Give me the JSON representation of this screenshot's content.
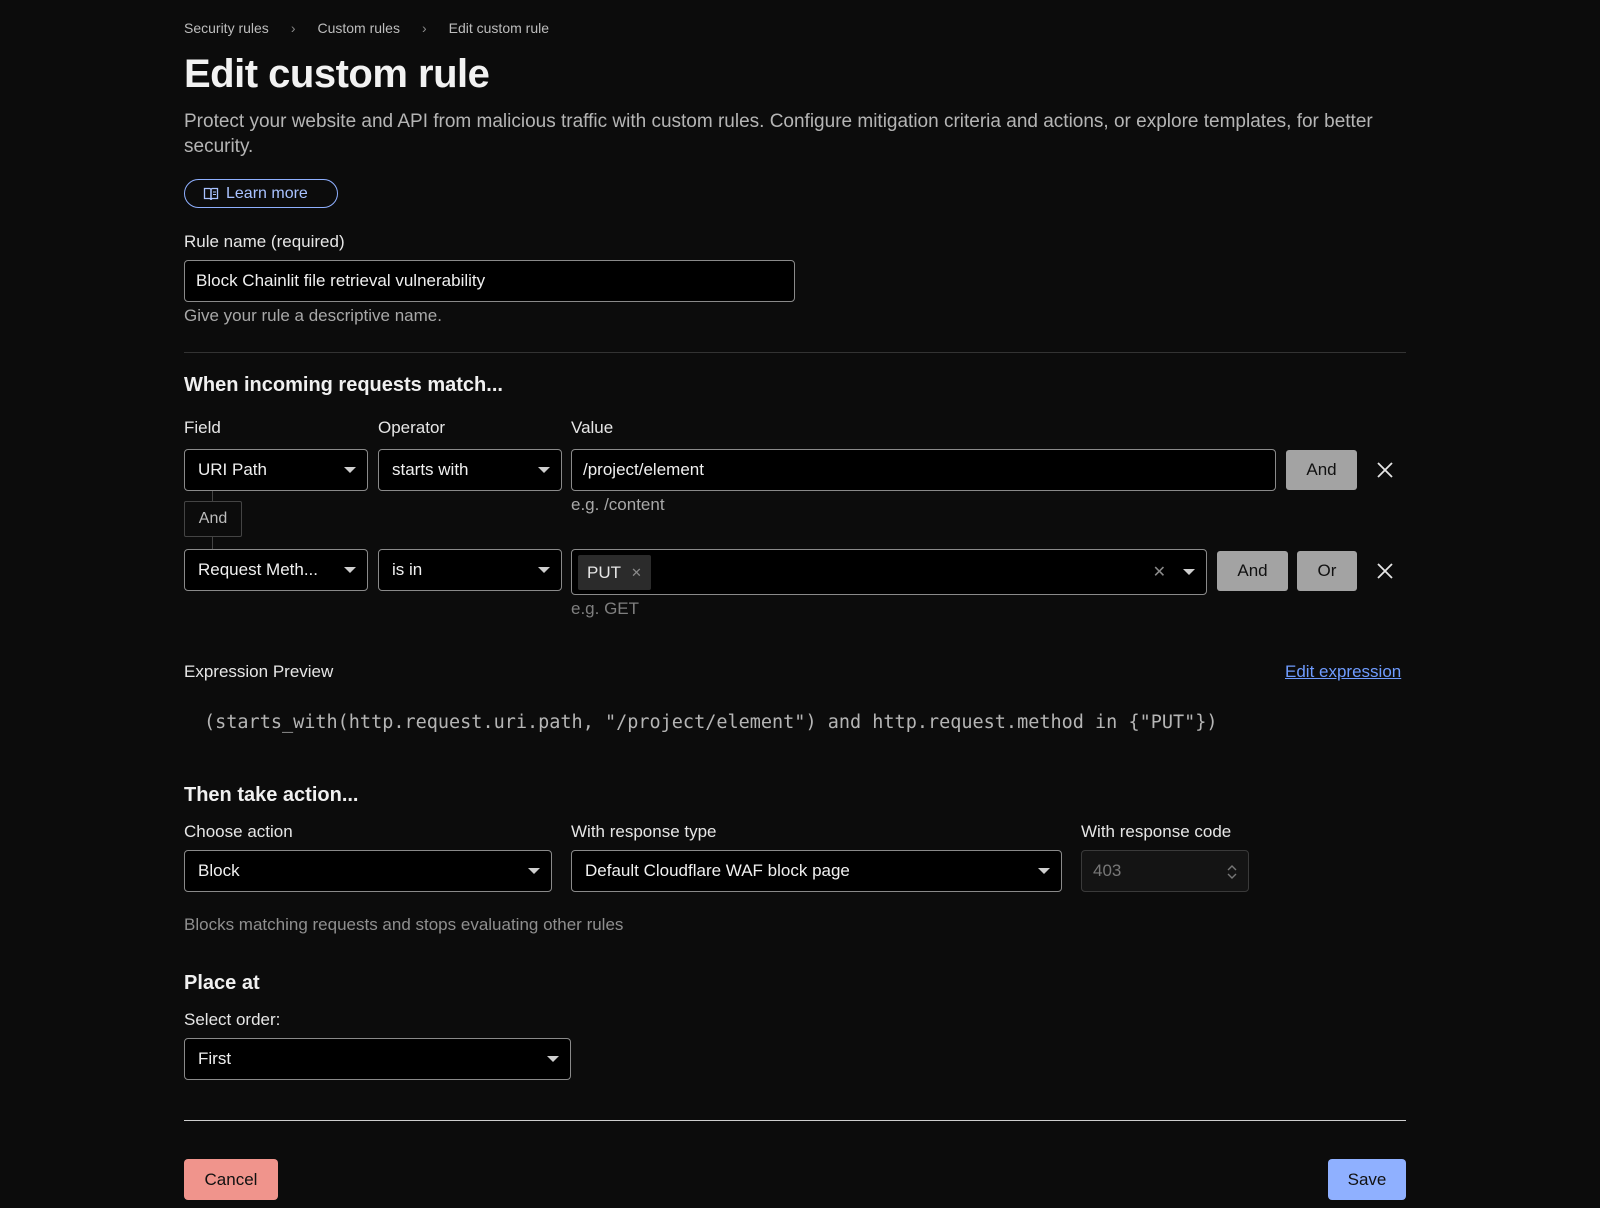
{
  "breadcrumb": {
    "items": [
      "Security rules",
      "Custom rules",
      "Edit custom rule"
    ],
    "separator": "›"
  },
  "page": {
    "title": "Edit custom rule",
    "description": "Protect your website and API from malicious traffic with custom rules. Configure mitigation criteria and actions, or explore templates, for better security.",
    "learn_more": "Learn more"
  },
  "rule_name": {
    "label": "Rule name (required)",
    "value": "Block Chainlit file retrieval vulnerability",
    "help": "Give your rule a descriptive name."
  },
  "match": {
    "heading": "When incoming requests match...",
    "field_label": "Field",
    "operator_label": "Operator",
    "value_label": "Value",
    "connector": "And",
    "rows": [
      {
        "field": "URI Path",
        "operator": "starts with",
        "value": "/project/element",
        "example": "e.g. /content",
        "buttons": [
          "And"
        ]
      },
      {
        "field": "Request Meth...",
        "operator": "is in",
        "tags": [
          "PUT"
        ],
        "example": "e.g. GET",
        "buttons": [
          "And",
          "Or"
        ]
      }
    ]
  },
  "expression": {
    "label": "Expression Preview",
    "edit_link": "Edit expression",
    "code": "(starts_with(http.request.uri.path, \"/project/element\") and http.request.method in {\"PUT\"})"
  },
  "action": {
    "heading": "Then take action...",
    "choose_label": "Choose action",
    "choose_value": "Block",
    "response_type_label": "With response type",
    "response_type_value": "Default Cloudflare WAF block page",
    "response_code_label": "With response code",
    "response_code_placeholder": "403",
    "help": "Blocks matching requests and stops evaluating other rules"
  },
  "place": {
    "heading": "Place at",
    "order_label": "Select order:",
    "order_value": "First"
  },
  "footer": {
    "cancel": "Cancel",
    "save": "Save"
  },
  "colors": {
    "background": "#0c0c0c",
    "link": "#6f9cff",
    "save": "#8fb0ff",
    "cancel": "#f0948c"
  }
}
